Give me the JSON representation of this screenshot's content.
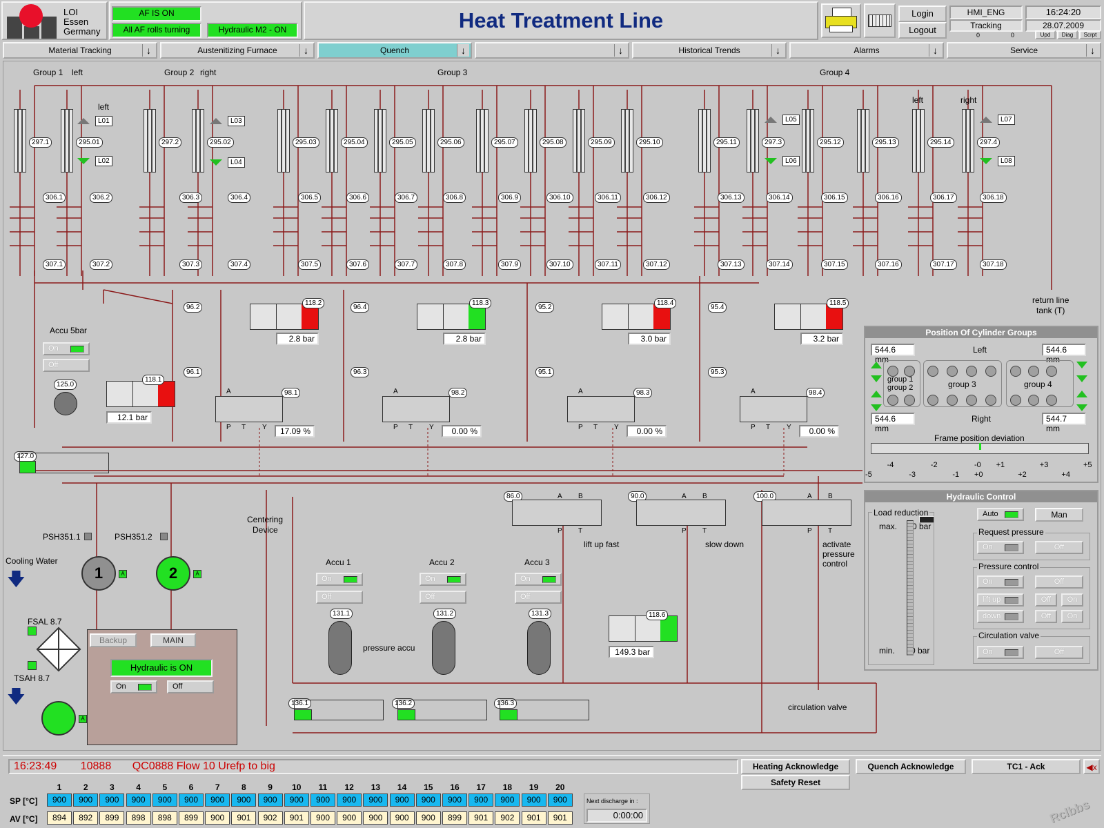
{
  "header": {
    "logo_lines": [
      "LOI",
      "Essen",
      "Germany"
    ],
    "status_af": "AF IS ON",
    "status_rolls": "All AF rolls turning",
    "status_hyd": "Hydraulic M2 - ON",
    "title": "Heat Treatment Line",
    "login": "Login",
    "logout": "Logout",
    "user": "HMI_ENG",
    "time": "16:24:20",
    "mode": "Tracking",
    "date": "28.07.2009",
    "count_a": "0",
    "count_b": "0",
    "small_buttons": [
      "Upd",
      "Diag",
      "Scrpt"
    ]
  },
  "nav": [
    "Material Tracking",
    "Austenitizing Furnace",
    "Quench",
    "",
    "Historical Trends",
    "Alarms",
    "Service"
  ],
  "groups": {
    "g1": "Group 1",
    "g1_side": "left",
    "g2": "Group 2",
    "g2_side": "right",
    "g3": "Group 3",
    "g4": "Group 4",
    "left": "left",
    "right": "right",
    "left2": "left"
  },
  "cyl_values": [
    "297.1",
    "295.01",
    "297.2",
    "295.02",
    "295.03",
    "295.04",
    "295.05",
    "295.06",
    "295.07",
    "295.08",
    "295.09",
    "295.10",
    "295.11",
    "297.3",
    "295.12",
    "295.13",
    "295.14",
    "297.4"
  ],
  "limit_tags": [
    "L01",
    "L02",
    "L03",
    "L04",
    "L05",
    "L06",
    "L07",
    "L08"
  ],
  "valves_top": [
    "306.1",
    "306.2",
    "306.3",
    "306.4",
    "306.5",
    "306.6",
    "306.7",
    "306.8",
    "306.9",
    "306.10",
    "306.11",
    "306.12",
    "306.13",
    "306.14",
    "306.15",
    "306.16",
    "306.17",
    "306.18"
  ],
  "valves_bot": [
    "307.1",
    "307.2",
    "307.3",
    "307.4",
    "307.5",
    "307.6",
    "307.7",
    "307.8",
    "307.9",
    "307.10",
    "307.11",
    "307.12",
    "307.13",
    "307.14",
    "307.15",
    "307.16",
    "307.17",
    "307.18"
  ],
  "pressure_units": [
    {
      "v_top": "96.2",
      "v_bot": "96.1",
      "sensor": "118.2",
      "bar": "2.8 bar",
      "prop": "98.1",
      "pct": "17.09",
      "alarm": true
    },
    {
      "v_top": "96.4",
      "v_bot": "96.3",
      "sensor": "118.3",
      "bar": "2.8 bar",
      "prop": "98.2",
      "pct": "0.00",
      "alarm": false
    },
    {
      "v_top": "95.2",
      "v_bot": "95.1",
      "sensor": "118.4",
      "bar": "3.0 bar",
      "prop": "98.3",
      "pct": "0.00",
      "alarm": true
    },
    {
      "v_top": "95.4",
      "v_bot": "95.3",
      "sensor": "118.5",
      "bar": "3.2 bar",
      "prop": "98.4",
      "pct": "0.00",
      "alarm": true
    }
  ],
  "pct_unit": "%",
  "return_line": [
    "return line",
    "tank (T)"
  ],
  "accu5": {
    "label": "Accu 5bar",
    "on": "On",
    "off": "Off",
    "tank": "125.0",
    "sensor": "118.1",
    "bar": "12.1 bar"
  },
  "valve127": "127.0",
  "pumps": {
    "psh1": "PSH351.1",
    "psh2": "PSH351.2",
    "p1": "1",
    "p2": "2",
    "a": "A",
    "cooling": "Cooling Water",
    "fsal": "FSAL 8.7",
    "tsah": "TSAH 8.7",
    "backup": "Backup",
    "main": "MAIN",
    "hyd_on": "Hydraulic is ON",
    "on": "On",
    "off": "Off",
    "centering": [
      "Centering",
      "Device"
    ]
  },
  "accus": [
    {
      "label": "Accu 1",
      "id": "131.1",
      "on": "On",
      "off": "Off"
    },
    {
      "label": "Accu 2",
      "id": "131.2",
      "on": "On",
      "off": "Off"
    },
    {
      "label": "Accu 3",
      "id": "131.3",
      "on": "On",
      "off": "Off"
    }
  ],
  "pressure_accu": "pressure accu",
  "bottom_valves": [
    "136.1",
    "136.2",
    "136.3"
  ],
  "dir_valves": [
    {
      "id": "86.0",
      "label": "lift up fast"
    },
    {
      "id": "90.0",
      "label": "slow down"
    },
    {
      "id": "100.0",
      "label": "activate pressure control"
    }
  ],
  "port_letters": {
    "a": "A",
    "b": "B",
    "p": "P",
    "t": "T",
    "y": "Y"
  },
  "sensor6": {
    "id": "118.6",
    "bar": "149.3 bar"
  },
  "circulation_valve": "circulation valve",
  "position_panel": {
    "title": "Position Of Cylinder Groups",
    "left": "Left",
    "right": "Right",
    "tl": "544.6 mm",
    "tr": "544.6 mm",
    "bl": "544.6 mm",
    "br": "544.7 mm",
    "g12a": "group 1",
    "g12b": "group 2",
    "g3": "group 3",
    "g4": "group 4",
    "dev_title": "Frame position deviation",
    "scale": [
      "-5",
      "-4",
      "-3",
      "-2",
      "-1",
      "-0",
      "+0",
      "+1",
      "+2",
      "+3",
      "+4",
      "+5"
    ],
    "deviation": 0.0
  },
  "hyd_panel": {
    "title": "Hydraulic Control",
    "load_red": "Load reduction",
    "max": "max.",
    "min": "min.",
    "max_val": "0 bar",
    "min_val": "0 bar",
    "auto": "Auto",
    "man": "Man",
    "req": "Request pressure",
    "pc": "Pressure control",
    "circ": "Circulation valve",
    "on": "On",
    "off": "Off",
    "liftup": "lift up",
    "down": "down"
  },
  "alarm": {
    "time": "16:23:49",
    "code": "10888",
    "text": "QC0888 Flow 10 Urefp to big"
  },
  "ack": {
    "heating": "Heating Acknowledge",
    "quench": "Quench Acknowledge",
    "tc1": "TC1 - Ack",
    "safety": "Safety Reset"
  },
  "temps": {
    "cols": [
      "1",
      "2",
      "3",
      "4",
      "5",
      "6",
      "7",
      "8",
      "9",
      "10",
      "11",
      "12",
      "13",
      "14",
      "15",
      "16",
      "17",
      "18",
      "19",
      "20"
    ],
    "sp_label": "SP  [°C]",
    "av_label": "AV  [°C]",
    "sp": [
      "900",
      "900",
      "900",
      "900",
      "900",
      "900",
      "900",
      "900",
      "900",
      "900",
      "900",
      "900",
      "900",
      "900",
      "900",
      "900",
      "900",
      "900",
      "900",
      "900"
    ],
    "av": [
      "894",
      "892",
      "899",
      "898",
      "898",
      "899",
      "900",
      "901",
      "902",
      "901",
      "900",
      "900",
      "900",
      "900",
      "900",
      "899",
      "901",
      "902",
      "901",
      "901"
    ]
  },
  "discharge": {
    "label": "Next discharge in :",
    "value": "0:00:00"
  },
  "watermark": "Rclbbs",
  "colors": {
    "line": "#8b1a1a",
    "green": "#22e022",
    "red": "#e81010",
    "title": "#102a80",
    "alarm": "#cc0000"
  }
}
